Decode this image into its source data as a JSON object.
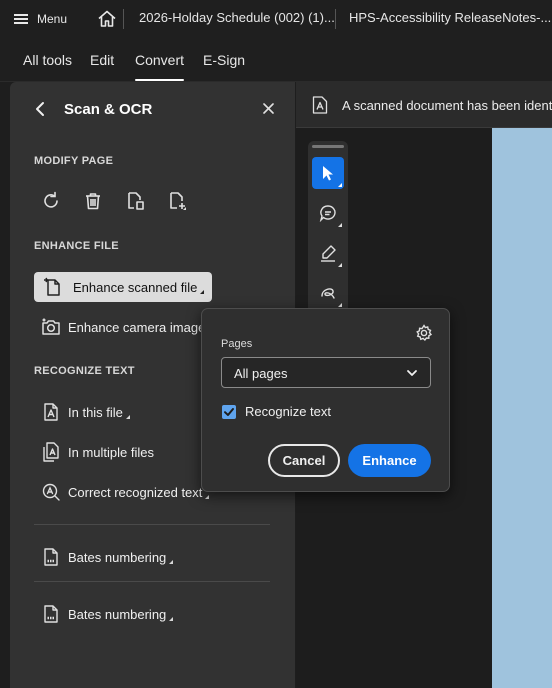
{
  "tabbar": {
    "menu_label": "Menu",
    "tabs": [
      {
        "label": "2026-Holday Schedule (002) (1)..."
      },
      {
        "label": "HPS-Accessibility ReleaseNotes-..."
      }
    ]
  },
  "menubar": {
    "items": [
      {
        "label": "All tools"
      },
      {
        "label": "Edit"
      },
      {
        "label": "Convert",
        "active": true
      },
      {
        "label": "E-Sign"
      }
    ]
  },
  "panel": {
    "title": "Scan & OCR",
    "modify_page": {
      "heading": "MODIFY PAGE",
      "icons": [
        "rotate-icon",
        "delete-icon",
        "extract-page-icon",
        "insert-page-icon"
      ]
    },
    "enhance_file": {
      "heading": "ENHANCE FILE",
      "items": [
        {
          "label": "Enhance scanned file",
          "icon": "enhance-scan-icon",
          "selected": true
        },
        {
          "label": "Enhance camera image",
          "icon": "camera-icon"
        }
      ]
    },
    "recognize_text": {
      "heading": "RECOGNIZE TEXT",
      "items": [
        {
          "label": "In this file",
          "icon": "text-file-icon"
        },
        {
          "label": "In multiple files",
          "icon": "multiple-files-icon"
        },
        {
          "label": "Correct recognized text",
          "icon": "correct-text-icon"
        }
      ]
    },
    "bates": [
      {
        "label": "Bates numbering"
      },
      {
        "label": "Bates numbering"
      }
    ]
  },
  "notification": {
    "text": "A scanned document has been identif"
  },
  "popup": {
    "pages_label": "Pages",
    "pages_value": "All pages",
    "checkbox_label": "Recognize text",
    "checkbox_checked": true,
    "cancel_label": "Cancel",
    "enhance_label": "Enhance"
  },
  "colors": {
    "accent": "#1473e6",
    "panel_bg": "#323232",
    "page_preview": "#9fc3dd"
  }
}
